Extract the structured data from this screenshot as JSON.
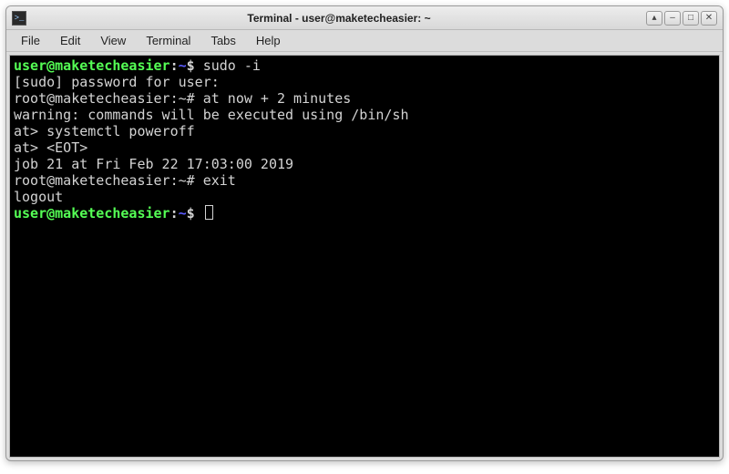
{
  "window": {
    "title": "Terminal - user@maketecheasier: ~"
  },
  "menu": {
    "file": "File",
    "edit": "Edit",
    "view": "View",
    "terminal": "Terminal",
    "tabs": "Tabs",
    "help": "Help"
  },
  "term": {
    "line1_user": "user@maketecheasier",
    "line1_colon": ":",
    "line1_path": "~",
    "line1_prompt": "$ ",
    "line1_cmd": "sudo -i",
    "line2": "[sudo] password for user:",
    "line3": "root@maketecheasier:~# at now + 2 minutes",
    "line4": "warning: commands will be executed using /bin/sh",
    "line5": "at> systemctl poweroff",
    "line6": "at> <EOT>",
    "line7": "job 21 at Fri Feb 22 17:03:00 2019",
    "line8": "root@maketecheasier:~# exit",
    "line9": "logout",
    "line10_user": "user@maketecheasier",
    "line10_colon": ":",
    "line10_path": "~",
    "line10_prompt": "$ "
  },
  "icons": {
    "app": ">_",
    "up": "▴",
    "min": "–",
    "max": "□",
    "close": "✕"
  }
}
